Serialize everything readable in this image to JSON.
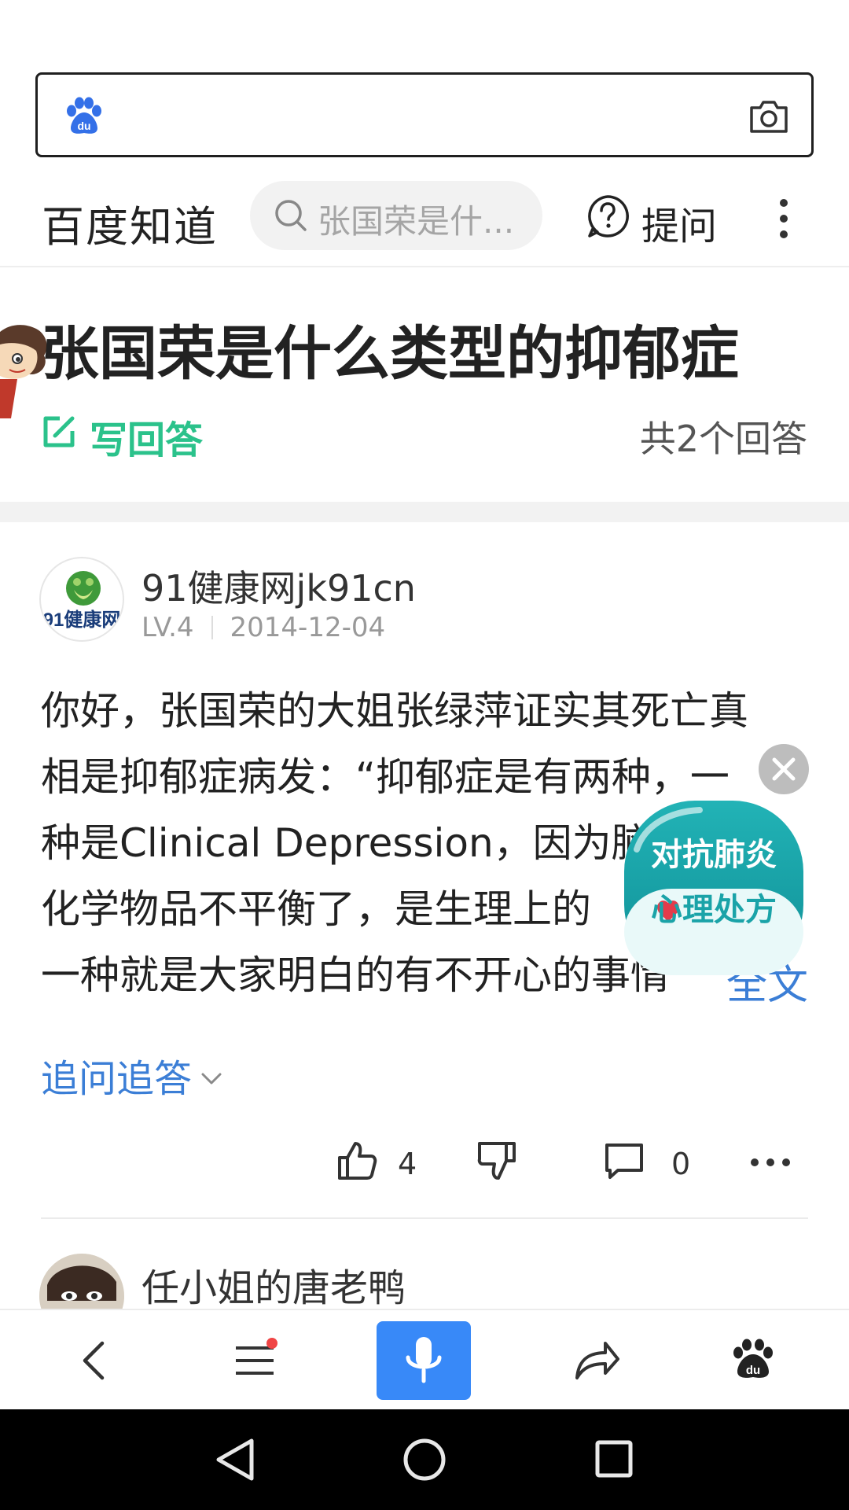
{
  "search_bar": {
    "logo_icon": "baidu-paw-icon",
    "camera_icon": "camera-icon"
  },
  "header": {
    "brand": "百度知道",
    "search_placeholder": "张国荣是什...",
    "ask_label": "提问"
  },
  "question": {
    "title": "张国荣是什么类型的抑郁症",
    "write_answer_label": "写回答",
    "answer_count": "共2个回答"
  },
  "answers": [
    {
      "author": "91健康网jk91cn",
      "avatar_text": "91健康网",
      "level": "LV.4",
      "date": "2014-12-04",
      "body_lines": [
        "你好，张国荣的大姐张绿萍证实其死亡真",
        "相是抑郁症病发：“抑郁症是有两种，一",
        "种是Clinical Depression，因为脑",
        "化学物品不平衡了，是生理上的",
        "一种就是大家明白的有不开心的事情"
      ],
      "full_text_label": "全文",
      "followup_label": "追问追答",
      "like_count": "4",
      "comment_count": "0"
    },
    {
      "author": "任小姐的唐老鸭"
    }
  ],
  "float_ad": {
    "line1": "对抗肺炎",
    "line2": "心理处方"
  },
  "colors": {
    "accent_green": "#2bc28b",
    "link_blue": "#3b7ed6",
    "mic_blue": "#3889f8",
    "ad_teal": "#1aa3a8"
  }
}
